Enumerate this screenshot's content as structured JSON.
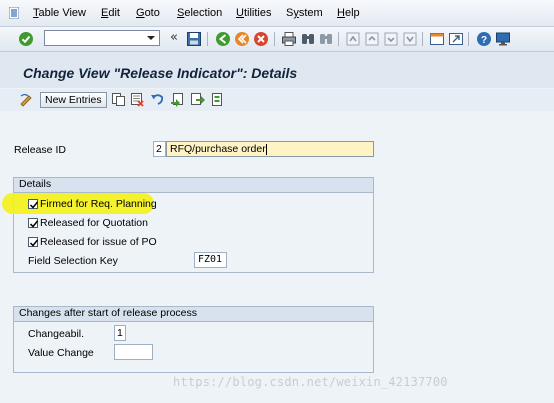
{
  "menu": {
    "items": [
      "Table View",
      "Edit",
      "Goto",
      "Selection",
      "Utilities",
      "System",
      "Help"
    ],
    "first_letters": [
      "T",
      "E",
      "G",
      "S",
      "U",
      "y",
      "H"
    ]
  },
  "toolbar": {
    "command_field_value": "",
    "chevron": "«",
    "icons": [
      "enter-icon",
      "save-icon",
      "back-icon",
      "exit-icon",
      "cancel-icon",
      "print-icon",
      "find-icon",
      "find-next-icon",
      "first-page-icon",
      "previous-page-icon",
      "next-page-icon",
      "last-page-icon",
      "new-session-icon",
      "shortcut-icon",
      "help-icon",
      "customize-layout-icon"
    ]
  },
  "title": "Change View \"Release Indicator\": Details",
  "app_toolbar": {
    "new_entries_label": "New Entries"
  },
  "form": {
    "release_id_label": "Release ID",
    "release_id_value": "2",
    "release_id_description": "RFQ/purchase order"
  },
  "details": {
    "title": "Details",
    "checkboxes": [
      {
        "label": "Firmed for Req. Planning",
        "checked": true
      },
      {
        "label": "Released for Quotation",
        "checked": true
      },
      {
        "label": "Released for issue of PO",
        "checked": true
      }
    ],
    "field_selection_key_label": "Field Selection Key",
    "field_selection_key_value": "FZ01"
  },
  "changes": {
    "title": "Changes after start of release process",
    "changeabil_label": "Changeabil.",
    "changeabil_value": "1",
    "value_change_label": "Value Change",
    "value_change_value": ""
  },
  "watermark": "https://blog.csdn.net/weixin_42137700",
  "colors": {
    "background": "#eef3f8",
    "title_text": "#13243a",
    "editable_field": "#fff3c4",
    "highlight": "#f4f11b",
    "enter_green": "#3f9a2f",
    "exit_orange": "#e8862a",
    "cancel_red": "#d9452b"
  }
}
